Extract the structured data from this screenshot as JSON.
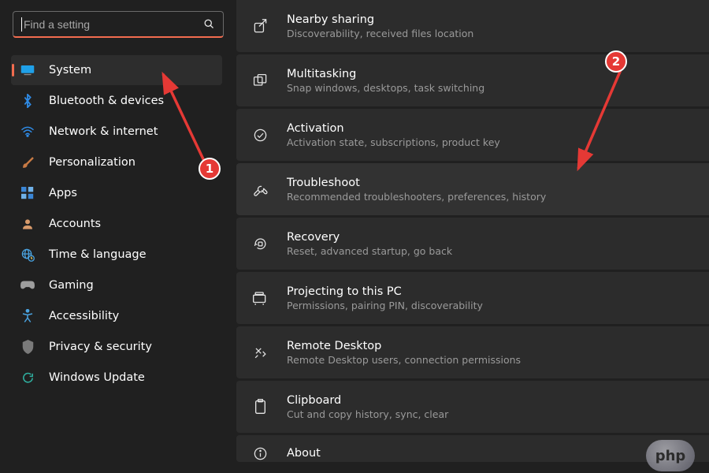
{
  "search": {
    "placeholder": "Find a setting"
  },
  "sidebar": {
    "items": [
      {
        "label": "System",
        "icon": "monitor",
        "selected": true
      },
      {
        "label": "Bluetooth & devices",
        "icon": "bluetooth"
      },
      {
        "label": "Network & internet",
        "icon": "wifi"
      },
      {
        "label": "Personalization",
        "icon": "brush"
      },
      {
        "label": "Apps",
        "icon": "grid"
      },
      {
        "label": "Accounts",
        "icon": "person"
      },
      {
        "label": "Time & language",
        "icon": "globe-clock"
      },
      {
        "label": "Gaming",
        "icon": "gamepad"
      },
      {
        "label": "Accessibility",
        "icon": "accessibility"
      },
      {
        "label": "Privacy & security",
        "icon": "shield"
      },
      {
        "label": "Windows Update",
        "icon": "update"
      }
    ]
  },
  "settings": [
    {
      "title": "Nearby sharing",
      "sub": "Discoverability, received files location",
      "icon": "share"
    },
    {
      "title": "Multitasking",
      "sub": "Snap windows, desktops, task switching",
      "icon": "windows-stack"
    },
    {
      "title": "Activation",
      "sub": "Activation state, subscriptions, product key",
      "icon": "check-circle"
    },
    {
      "title": "Troubleshoot",
      "sub": "Recommended troubleshooters, preferences, history",
      "icon": "wrench",
      "highlight": true
    },
    {
      "title": "Recovery",
      "sub": "Reset, advanced startup, go back",
      "icon": "recovery"
    },
    {
      "title": "Projecting to this PC",
      "sub": "Permissions, pairing PIN, discoverability",
      "icon": "projector"
    },
    {
      "title": "Remote Desktop",
      "sub": "Remote Desktop users, connection permissions",
      "icon": "remote"
    },
    {
      "title": "Clipboard",
      "sub": "Cut and copy history, sync, clear",
      "icon": "clipboard"
    },
    {
      "title": "About",
      "sub": "",
      "icon": "info",
      "partial": true
    }
  ],
  "annotations": {
    "badge1": "1",
    "badge2": "2",
    "php": "php"
  },
  "colors": {
    "accent": "#f26c4f",
    "annotation": "#e53935"
  }
}
